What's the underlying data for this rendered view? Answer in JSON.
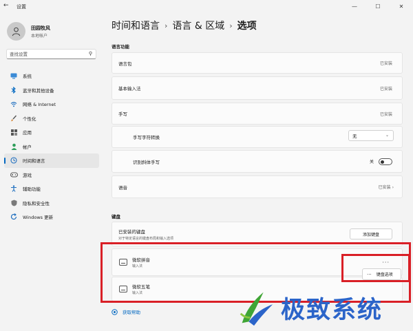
{
  "window": {
    "title": "设置"
  },
  "user": {
    "name": "田园牧风",
    "account_type": "本地帐户"
  },
  "search": {
    "placeholder": "查找设置"
  },
  "sidebar": {
    "items": [
      {
        "label": "系统",
        "icon": "monitor-icon"
      },
      {
        "label": "蓝牙和其他设备",
        "icon": "bluetooth-icon"
      },
      {
        "label": "网络 & Internet",
        "icon": "wifi-icon"
      },
      {
        "label": "个性化",
        "icon": "brush-icon"
      },
      {
        "label": "应用",
        "icon": "apps-icon"
      },
      {
        "label": "帐户",
        "icon": "person-icon"
      },
      {
        "label": "时间和语言",
        "icon": "globe-clock-icon",
        "active": true
      },
      {
        "label": "游戏",
        "icon": "gamepad-icon"
      },
      {
        "label": "辅助功能",
        "icon": "accessibility-icon"
      },
      {
        "label": "隐私和安全性",
        "icon": "shield-icon"
      },
      {
        "label": "Windows 更新",
        "icon": "update-icon"
      }
    ]
  },
  "breadcrumb": {
    "part1": "时间和语言",
    "part2": "语言 & 区域",
    "current": "选项"
  },
  "language_features": {
    "heading": "语言功能",
    "language_pack": {
      "label": "语言包",
      "value": "已安装"
    },
    "basic_typing": {
      "label": "基本输入法",
      "value": "已安装"
    },
    "handwriting": {
      "label": "手写",
      "value": "已安装"
    },
    "handwriting_conversion": {
      "label": "手写字符转换",
      "value": "无"
    },
    "cursive": {
      "label": "识别斜体手写",
      "toggle_label": "关",
      "on": false
    },
    "speech": {
      "label": "语音",
      "value": "已安装"
    }
  },
  "keyboard": {
    "heading": "键盘",
    "installed": {
      "title": "已安装的键盘",
      "subtitle": "对于特定语言的键盘布局和输入选项",
      "add_button": "添加键盘"
    },
    "items": [
      {
        "name": "微软拼音",
        "type": "输入法"
      },
      {
        "name": "微软五笔",
        "type": "输入法"
      }
    ],
    "options_button": "键盘选项"
  },
  "help": {
    "label": "获取帮助"
  },
  "watermark": {
    "text": "极致系统"
  },
  "colors": {
    "accent": "#0067c0",
    "highlight": "#d91f26",
    "watermark": "#2b64c9"
  }
}
